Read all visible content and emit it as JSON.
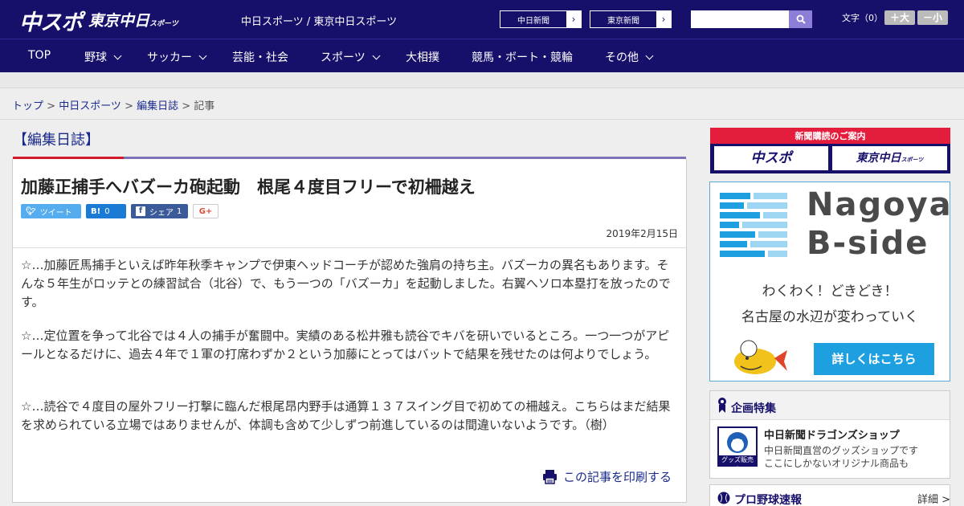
{
  "header": {
    "logo_main": "中スポ",
    "logo_tokyo": "東京中日",
    "logo_tokyo_small": "スポーツ",
    "site_names": "中日スポーツ / 東京中日スポーツ",
    "links": [
      {
        "label": "中日新聞"
      },
      {
        "label": "東京新聞"
      }
    ],
    "search": {
      "value": "",
      "placeholder": ""
    },
    "font_size_label": "文字（0）",
    "font_bigger": "＋大",
    "font_smaller": "－小"
  },
  "nav": [
    {
      "label": "TOP",
      "has_menu": false
    },
    {
      "label": "野球",
      "has_menu": true
    },
    {
      "label": "サッカー",
      "has_menu": true
    },
    {
      "label": "芸能・社会",
      "has_menu": false
    },
    {
      "label": "スポーツ",
      "has_menu": true
    },
    {
      "label": "大相撲",
      "has_menu": false
    },
    {
      "label": "競馬・ボート・競輪",
      "has_menu": false
    },
    {
      "label": "その他",
      "has_menu": true
    }
  ],
  "breadcrumb": {
    "items": [
      "トップ",
      "中日スポーツ",
      "編集日誌"
    ],
    "current": "記事",
    "sep": " > "
  },
  "article": {
    "section": "【編集日誌】",
    "headline": "加藤正捕手へバズーカ砲起動　根尾４度目フリーで初柵越え",
    "share": {
      "tweet": "ツイート",
      "hatena_icon": "B!",
      "hatena_count": "0",
      "facebook_label": "シェア",
      "facebook_count": "1",
      "gplus": "G+"
    },
    "date": "2019年2月15日",
    "paragraphs": [
      "☆…加藤匠馬捕手といえば昨年秋季キャンプで伊東ヘッドコーチが認めた強肩の持ち主。バズーカの異名もあります。そんな５年生がロッテとの練習試合（北谷）で、もう一つの「バズーカ」を起動しました。右翼へソロ本塁打を放ったのです。",
      "☆…定位置を争って北谷では４人の捕手が奮闘中。実績のある松井雅も読谷でキバを研いでいるところ。一つ一つがアピールとなるだけに、過去４年で１軍の打席わずか２という加藤にとってはバットで結果を残せたのは何よりでしょう。",
      "☆…読谷で４度目の屋外フリー打撃に臨んだ根尾昂内野手は通算１３７スイング目で初めての柵越え。こちらはまだ結果を求められている立場ではありませんが、体調も含めて少しずつ前進しているのは間違いないようです。（樹）"
    ],
    "print_label": "この記事を印刷する"
  },
  "sidebar": {
    "subscription": {
      "title": "新聞購読のご案内",
      "logo_chuspo": "中スポ",
      "logo_tokyo": "東京中日",
      "logo_tokyo_small": "スポーツ"
    },
    "ad": {
      "title_line1": "Nagoya",
      "title_line2": "B-side",
      "tagline1": "わくわく！どきどき！",
      "tagline2": "名古屋の水辺が変わっていく",
      "button": "詳しくはこちら"
    },
    "feature": {
      "title": "企画特集",
      "item_name": "中日新聞ドラゴンズショップ",
      "item_desc1": "中日新聞直営のグッズショップです",
      "item_desc2": "ここにしかないオリジナル商品も",
      "thumb_label": "グッズ販売中"
    },
    "baseball": {
      "title": "プロ野球速報",
      "more": "詳細 >"
    }
  },
  "colors": {
    "brand_navy": "#17106b",
    "accent_red": "#e51d3d",
    "link_blue": "#1a2a8c",
    "ad_blue": "#1ea0e0"
  }
}
